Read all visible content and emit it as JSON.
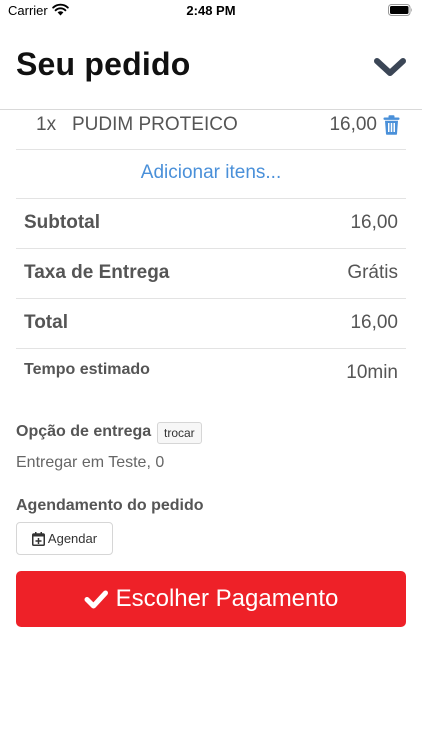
{
  "status_bar": {
    "carrier": "Carrier",
    "time": "2:48 PM",
    "wifi_icon": "wifi-icon",
    "battery_icon": "battery-full-icon"
  },
  "header": {
    "title": "Seu pedido",
    "collapse_icon": "chevron-down-icon"
  },
  "order_items": [
    {
      "quantity": "1x",
      "name": "PUDIM PROTEICO",
      "price": "16,00",
      "remove_icon": "trash-icon"
    }
  ],
  "add_items_label": "Adicionar itens...",
  "summary": {
    "subtotal_label": "Subtotal",
    "subtotal_value": "16,00",
    "delivery_fee_label": "Taxa de Entrega",
    "delivery_fee_value": "Grátis",
    "total_label": "Total",
    "total_value": "16,00",
    "estimated_time_label": "Tempo estimado",
    "estimated_time_value": "10min"
  },
  "delivery": {
    "label": "Opção de entrega",
    "change_label": "trocar",
    "address": "Entregar em Teste, 0"
  },
  "scheduling": {
    "label": "Agendamento do pedido",
    "button_label": "Agendar",
    "button_icon": "calendar-plus-icon"
  },
  "payment_button": {
    "label": "Escolher Pagamento",
    "icon": "check-icon"
  },
  "colors": {
    "accent_red": "#ee2128",
    "link_blue": "#4a90d9",
    "chevron": "#3b4656"
  }
}
